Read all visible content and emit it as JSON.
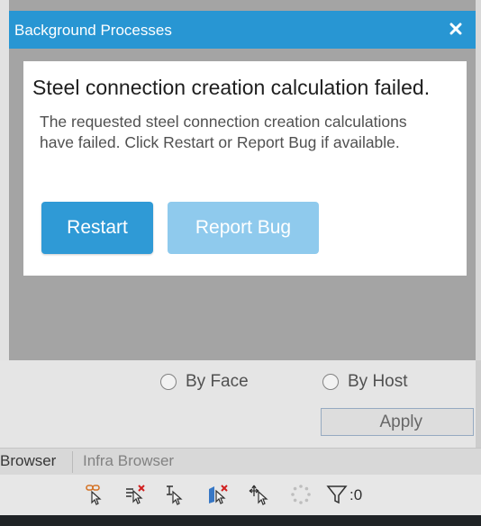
{
  "dialog": {
    "title": "Background Processes",
    "close_icon": "close-icon",
    "headline": "Steel connection creation calculation failed.",
    "message": "The requested steel connection creation calculations have failed. Click Restart or Report Bug if available.",
    "restart_label": "Restart",
    "report_bug_label": "Report Bug"
  },
  "background": {
    "radio_by_face": "By Face",
    "radio_by_host": "By Host",
    "apply_label": "Apply",
    "tabs": [
      "Browser",
      "Infra Browser"
    ],
    "filter_count": ":0",
    "toolbar_icons": [
      "select-links-icon",
      "select-underlay-icon",
      "select-pinned-icon",
      "select-by-face-icon",
      "drag-elements-icon",
      "background-process-icon",
      "filter-icon"
    ]
  },
  "colors": {
    "titlebar": "#2896d3",
    "primary_button": "#2f9ad6",
    "disabled_button": "#8fcaed"
  }
}
